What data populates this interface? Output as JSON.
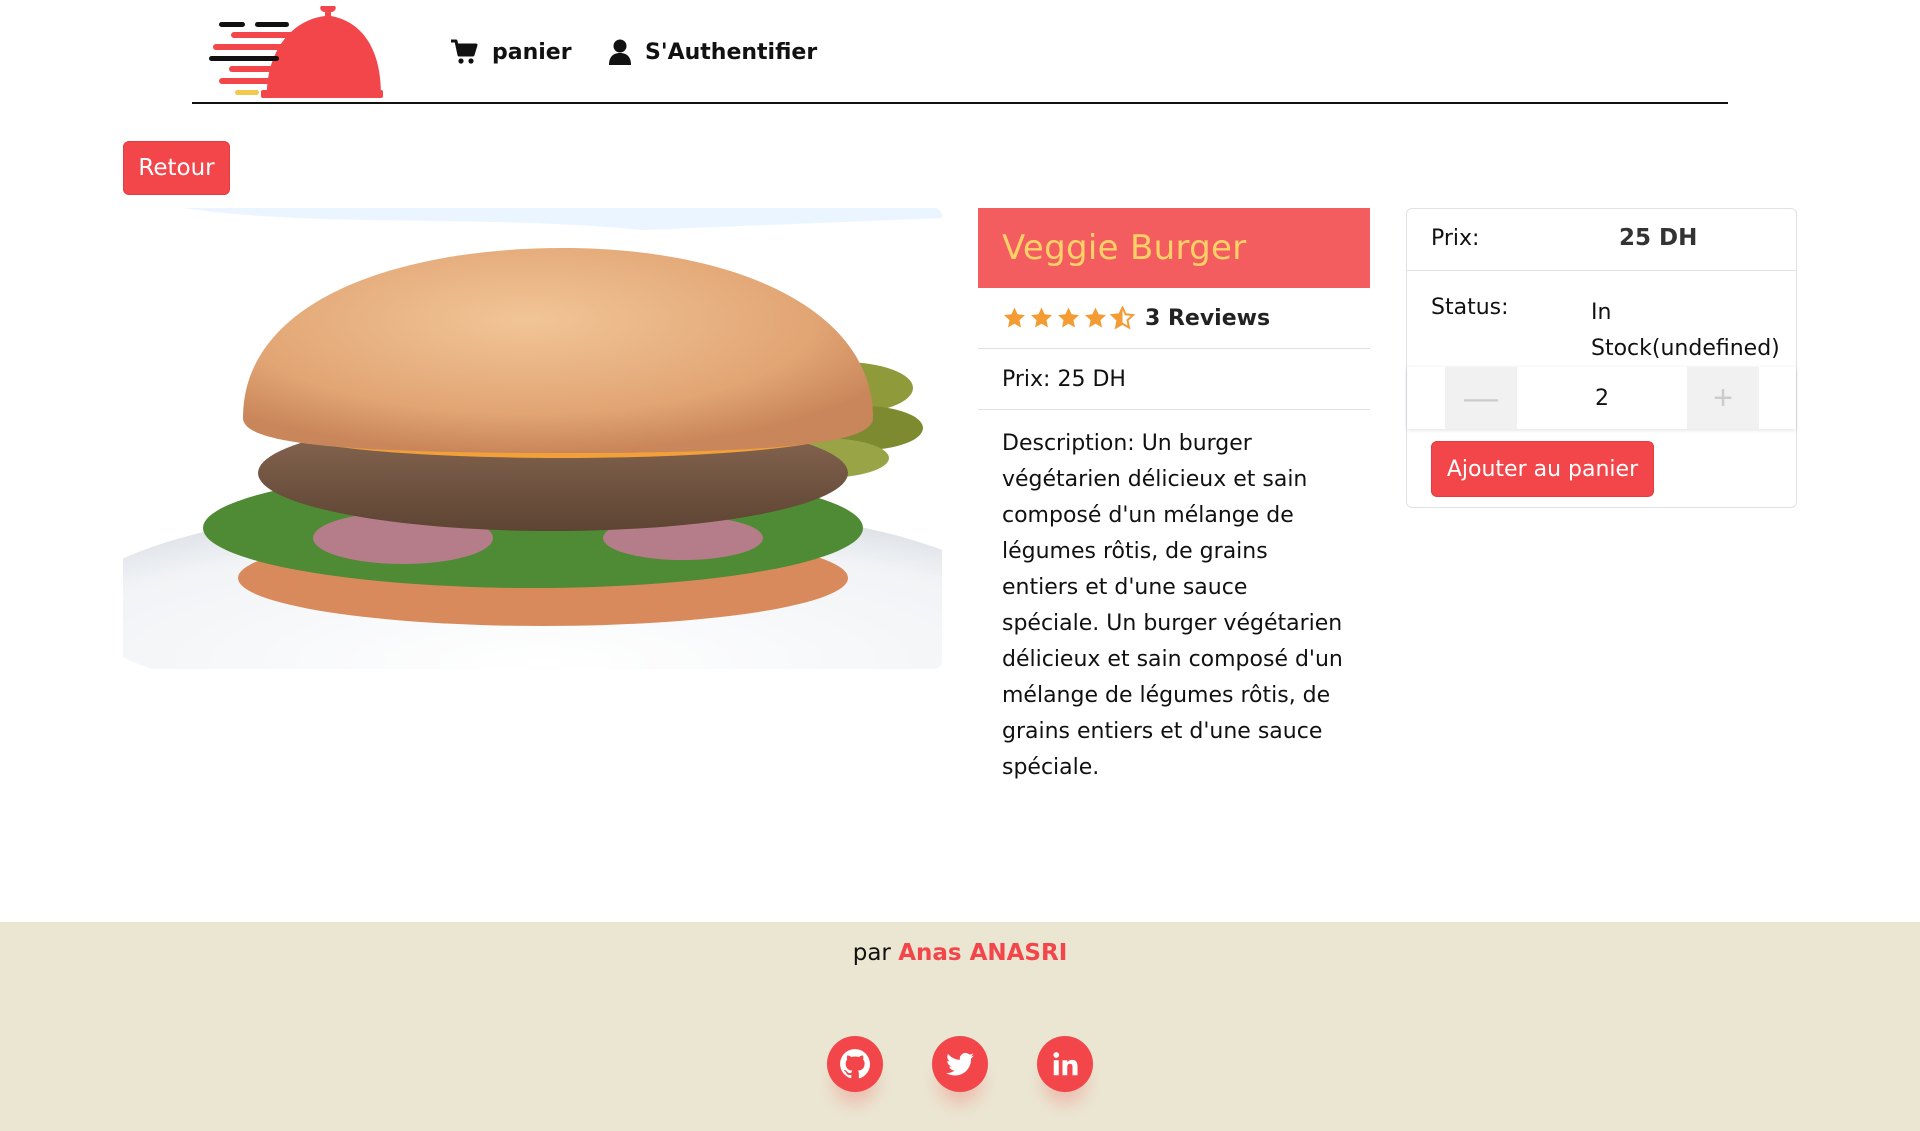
{
  "nav": {
    "cart_label": "panier",
    "auth_label": "S'Authentifier"
  },
  "back_label": "Retour",
  "product": {
    "name": "Veggie Burger",
    "rating": 4.5,
    "reviews_label": "3 Reviews",
    "price_line": "Prix: 25 DH",
    "description": "Description: Un burger végétarien délicieux et sain composé d'un mélange de légumes rôtis, de grains entiers et d'une sauce spéciale. Un burger végétarien délicieux et sain composé d'un mélange de légumes rôtis, de grains entiers et d'une sauce spéciale."
  },
  "card": {
    "price_label": "Prix:",
    "price_value": "25 DH",
    "status_label": "Status:",
    "status_value": "In Stock(undefined)",
    "quantity": "2",
    "minus_symbol": "—",
    "plus_symbol": "+",
    "add_label": "Ajouter au panier"
  },
  "footer": {
    "by_prefix": "par",
    "author": "Anas ANASRI"
  },
  "colors": {
    "accent": "#f2464b",
    "title_bg": "#f45d5f",
    "title_text": "#ffd166",
    "star": "#f39c34",
    "footer_bg": "#ebe6d2"
  }
}
